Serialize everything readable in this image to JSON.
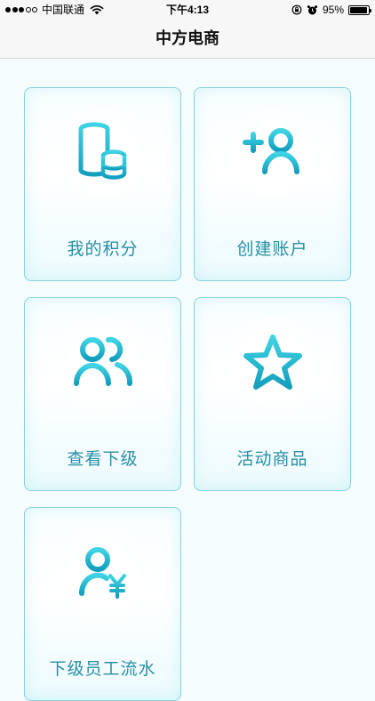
{
  "status_bar": {
    "carrier": "中国联通",
    "time": "下午4:13",
    "battery": "95%",
    "battery_level": 0.95
  },
  "nav": {
    "title": "中方电商"
  },
  "menu": [
    {
      "label": "我的积分",
      "icon": "points-coins-icon"
    },
    {
      "label": "创建账户",
      "icon": "add-user-icon"
    },
    {
      "label": "查看下级",
      "icon": "subordinates-icon"
    },
    {
      "label": "活动商品",
      "icon": "star-icon"
    },
    {
      "label": "下级员工流水",
      "icon": "user-yuan-icon"
    }
  ],
  "colors": {
    "accent": "#22b6cf",
    "label": "#2a8fa5",
    "card_border": "#88d2df"
  }
}
